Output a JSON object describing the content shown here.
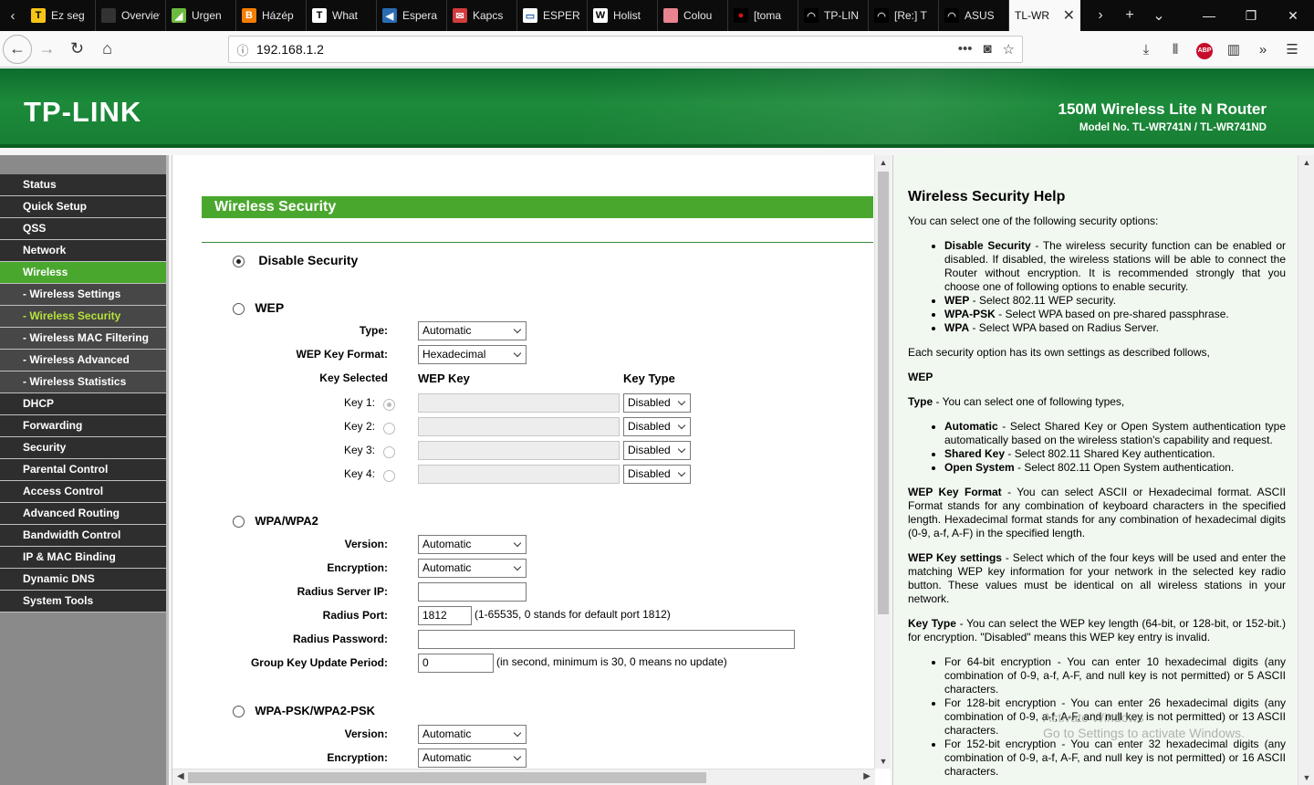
{
  "browser": {
    "tabs": [
      {
        "label": "Ez seg",
        "icon": "T",
        "color": "#f5c518",
        "text_color": "#000"
      },
      {
        "label": "Overview",
        "icon": "",
        "color": "#333",
        "text_color": "#fff"
      },
      {
        "label": "Urgen",
        "icon": "◢",
        "color": "#6cba3f",
        "text_color": "#fff"
      },
      {
        "label": "Házép",
        "icon": "B",
        "color": "#f57d00",
        "text_color": "#fff"
      },
      {
        "label": "What",
        "icon": "T",
        "color": "#fff",
        "text_color": "#000"
      },
      {
        "label": "Espera",
        "icon": "◀",
        "color": "#2b6cb0",
        "text_color": "#fff"
      },
      {
        "label": "Kapcs",
        "icon": "✉",
        "color": "#d23c3c",
        "text_color": "#fff"
      },
      {
        "label": "ESPER",
        "icon": "▭",
        "color": "#fff",
        "text_color": "#2a64b0"
      },
      {
        "label": "Holist",
        "icon": "W",
        "color": "#fff",
        "text_color": "#000"
      },
      {
        "label": "Colou",
        "icon": "■",
        "color": "#e8838f",
        "text_color": "#e8838f"
      },
      {
        "label": "[toma",
        "icon": "●",
        "color": "#000",
        "text_color": "#d11"
      },
      {
        "label": "TP-LIN",
        "icon": "◠",
        "color": "#000",
        "text_color": "#ccc"
      },
      {
        "label": "[Re:] T",
        "icon": "◠",
        "color": "#000",
        "text_color": "#ccc"
      },
      {
        "label": "ASUS",
        "icon": "◠",
        "color": "#000",
        "text_color": "#ccc"
      }
    ],
    "active_tab": {
      "label": "TL-WR",
      "close": "✕"
    },
    "url": "192.168.1.2",
    "window_controls": {
      "minimize": "—",
      "restore": "❐",
      "close": "✕"
    }
  },
  "header": {
    "logo": "TP-LINK",
    "product": "150M Wireless Lite N Router",
    "model": "Model No. TL-WR741N / TL-WR741ND"
  },
  "sidebar": {
    "items": [
      {
        "label": "Status",
        "type": "main",
        "state": ""
      },
      {
        "label": "Quick Setup",
        "type": "main",
        "state": ""
      },
      {
        "label": "QSS",
        "type": "main",
        "state": ""
      },
      {
        "label": "Network",
        "type": "main",
        "state": ""
      },
      {
        "label": "Wireless",
        "type": "main",
        "state": "active"
      },
      {
        "label": "- Wireless Settings",
        "type": "sub",
        "state": ""
      },
      {
        "label": "- Wireless Security",
        "type": "sub",
        "state": "current"
      },
      {
        "label": "- Wireless MAC Filtering",
        "type": "sub",
        "state": ""
      },
      {
        "label": "- Wireless Advanced",
        "type": "sub",
        "state": ""
      },
      {
        "label": "- Wireless Statistics",
        "type": "sub",
        "state": ""
      },
      {
        "label": "DHCP",
        "type": "main",
        "state": ""
      },
      {
        "label": "Forwarding",
        "type": "main",
        "state": ""
      },
      {
        "label": "Security",
        "type": "main",
        "state": ""
      },
      {
        "label": "Parental Control",
        "type": "main",
        "state": ""
      },
      {
        "label": "Access Control",
        "type": "main",
        "state": ""
      },
      {
        "label": "Advanced Routing",
        "type": "main",
        "state": ""
      },
      {
        "label": "Bandwidth Control",
        "type": "main",
        "state": ""
      },
      {
        "label": "IP & MAC Binding",
        "type": "main",
        "state": ""
      },
      {
        "label": "Dynamic DNS",
        "type": "main",
        "state": ""
      },
      {
        "label": "System Tools",
        "type": "main",
        "state": ""
      }
    ]
  },
  "main": {
    "title": "Wireless Security",
    "disable_security": {
      "label": "Disable Security",
      "checked": true
    },
    "wep": {
      "label": "WEP",
      "type_label": "Type:",
      "type_value": "Automatic",
      "format_label": "WEP Key Format:",
      "format_value": "Hexadecimal",
      "key_selected_label": "Key Selected",
      "wep_key_header": "WEP Key",
      "key_type_header": "Key Type",
      "keys": [
        {
          "label": "Key 1:",
          "value": "",
          "type": "Disabled"
        },
        {
          "label": "Key 2:",
          "value": "",
          "type": "Disabled"
        },
        {
          "label": "Key 3:",
          "value": "",
          "type": "Disabled"
        },
        {
          "label": "Key 4:",
          "value": "",
          "type": "Disabled"
        }
      ]
    },
    "wpa": {
      "label": "WPA/WPA2",
      "version_label": "Version:",
      "version_value": "Automatic",
      "encryption_label": "Encryption:",
      "encryption_value": "Automatic",
      "radius_ip_label": "Radius Server IP:",
      "radius_ip_value": "",
      "radius_port_label": "Radius Port:",
      "radius_port_value": "1812",
      "radius_port_note": "(1-65535, 0 stands for default port 1812)",
      "radius_password_label": "Radius Password:",
      "radius_password_value": "",
      "group_key_label": "Group Key Update Period:",
      "group_key_value": "0",
      "group_key_note": "(in second, minimum is 30, 0 means no update)"
    },
    "wpa_psk": {
      "label": "WPA-PSK/WPA2-PSK",
      "version_label": "Version:",
      "version_value": "Automatic",
      "encryption_label": "Encryption:",
      "encryption_value": "Automatic"
    }
  },
  "help": {
    "title": "Wireless Security Help",
    "intro": "You can select one of the following security options:",
    "options": [
      {
        "term": "Disable Security",
        "text": " - The wireless security function can be enabled or disabled. If disabled, the wireless stations will be able to connect the Router without encryption. It is recommended strongly that you choose one of following options to enable security."
      },
      {
        "term": "WEP",
        "text": " - Select 802.11 WEP security."
      },
      {
        "term": "WPA-PSK",
        "text": " - Select WPA based on pre-shared passphrase."
      },
      {
        "term": "WPA",
        "text": " - Select WPA based on Radius Server."
      }
    ],
    "each": "Each security option has its own settings as described follows,",
    "wep_heading": "WEP",
    "type_term": "Type",
    "type_text": " - You can select one of following types,",
    "types": [
      {
        "term": "Automatic",
        "text": " - Select Shared Key or Open System authentication type automatically based on the wireless station's capability and request."
      },
      {
        "term": "Shared Key",
        "text": " - Select 802.11 Shared Key authentication."
      },
      {
        "term": "Open System",
        "text": " - Select 802.11 Open System authentication."
      }
    ],
    "format_term": "WEP Key Format",
    "format_text": " - You can select ASCII or Hexadecimal format. ASCII Format stands for any combination of keyboard characters in the specified length. Hexadecimal format stands for any combination of hexadecimal digits (0-9, a-f, A-F) in the specified length.",
    "settings_term": "WEP Key settings",
    "settings_text": " - Select which of the four keys will be used and enter the matching WEP key information for your network in the selected key radio button. These values must be identical on all wireless stations in your network.",
    "keytype_term": "Key Type",
    "keytype_text": " - You can select the WEP key length (64-bit, or 128-bit, or 152-bit.) for encryption. \"Disabled\" means this WEP key entry is invalid.",
    "lengths": [
      {
        "text": "For 64-bit encryption - You can enter 10 hexadecimal digits (any combination of 0-9, a-f, A-F, and null key is not permitted) or 5 ASCII characters."
      },
      {
        "text": "For 128-bit encryption - You can enter 26 hexadecimal digits (any combination of 0-9, a-f, A-F, and null key is not permitted) or 13 ASCII characters."
      },
      {
        "text": "For 152-bit encryption - You can enter 32 hexadecimal digits (any combination of 0-9, a-f, A-F, and null key is not permitted) or 16 ASCII characters."
      }
    ]
  },
  "watermark": {
    "line1": "Activate Windows",
    "line2": "Go to Settings to activate Windows."
  }
}
